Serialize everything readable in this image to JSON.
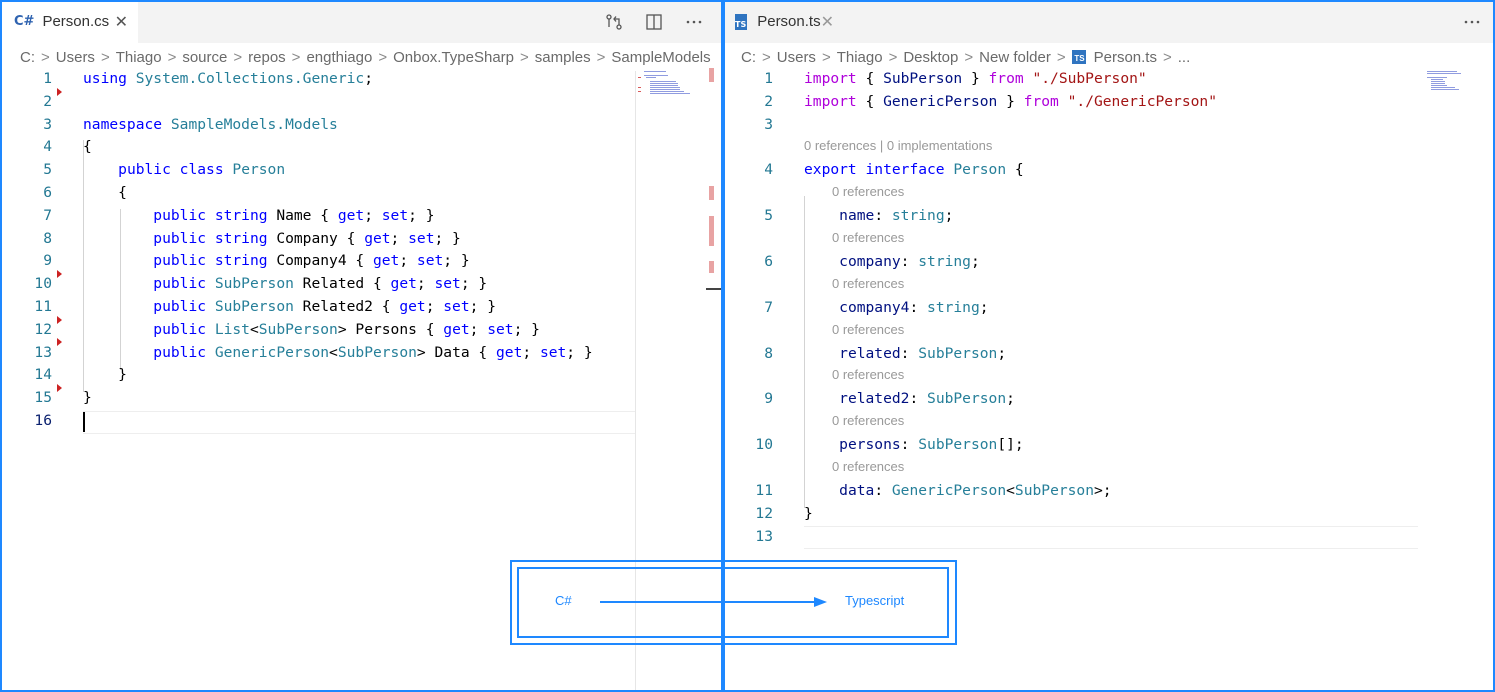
{
  "left_editor": {
    "tab": {
      "icon": "csharp-file-icon",
      "icon_text": "C#",
      "label": "Person.cs",
      "close": "✕"
    },
    "actions": [
      "open-changes-icon",
      "split-editor-icon",
      "more-actions-icon"
    ],
    "breadcrumb": [
      "C:",
      "Users",
      "Thiago",
      "source",
      "repos",
      "engthiago",
      "Onbox.TypeSharp",
      "samples",
      "SampleModels"
    ],
    "line_numbers": [
      "1",
      "2",
      "3",
      "4",
      "5",
      "6",
      "7",
      "8",
      "9",
      "10",
      "11",
      "12",
      "13",
      "14",
      "15",
      "16"
    ],
    "lines": [
      [
        [
          "kw",
          "using"
        ],
        [
          "pl",
          " "
        ],
        [
          "ty",
          "System.Collections.Generic"
        ],
        [
          "pl",
          ";"
        ]
      ],
      [],
      [
        [
          "kw",
          "namespace"
        ],
        [
          "pl",
          " "
        ],
        [
          "ty",
          "SampleModels.Models"
        ]
      ],
      [
        [
          "pl",
          "{"
        ]
      ],
      [
        [
          "pl",
          "    "
        ],
        [
          "kw",
          "public"
        ],
        [
          "pl",
          " "
        ],
        [
          "kw",
          "class"
        ],
        [
          "pl",
          " "
        ],
        [
          "ty",
          "Person"
        ]
      ],
      [
        [
          "pl",
          "    {"
        ]
      ],
      [
        [
          "pl",
          "        "
        ],
        [
          "kw",
          "public"
        ],
        [
          "pl",
          " "
        ],
        [
          "kw",
          "string"
        ],
        [
          "pl",
          " Name { "
        ],
        [
          "kw",
          "get"
        ],
        [
          "pl",
          "; "
        ],
        [
          "kw",
          "set"
        ],
        [
          "pl",
          "; }"
        ]
      ],
      [
        [
          "pl",
          "        "
        ],
        [
          "kw",
          "public"
        ],
        [
          "pl",
          " "
        ],
        [
          "kw",
          "string"
        ],
        [
          "pl",
          " Company { "
        ],
        [
          "kw",
          "get"
        ],
        [
          "pl",
          "; "
        ],
        [
          "kw",
          "set"
        ],
        [
          "pl",
          "; }"
        ]
      ],
      [
        [
          "pl",
          "        "
        ],
        [
          "kw",
          "public"
        ],
        [
          "pl",
          " "
        ],
        [
          "kw",
          "string"
        ],
        [
          "pl",
          " Company4 { "
        ],
        [
          "kw",
          "get"
        ],
        [
          "pl",
          "; "
        ],
        [
          "kw",
          "set"
        ],
        [
          "pl",
          "; }"
        ]
      ],
      [
        [
          "pl",
          "        "
        ],
        [
          "kw",
          "public"
        ],
        [
          "pl",
          " "
        ],
        [
          "ty",
          "SubPerson"
        ],
        [
          "pl",
          " Related { "
        ],
        [
          "kw",
          "get"
        ],
        [
          "pl",
          "; "
        ],
        [
          "kw",
          "set"
        ],
        [
          "pl",
          "; }"
        ]
      ],
      [
        [
          "pl",
          "        "
        ],
        [
          "kw",
          "public"
        ],
        [
          "pl",
          " "
        ],
        [
          "ty",
          "SubPerson"
        ],
        [
          "pl",
          " Related2 { "
        ],
        [
          "kw",
          "get"
        ],
        [
          "pl",
          "; "
        ],
        [
          "kw",
          "set"
        ],
        [
          "pl",
          "; }"
        ]
      ],
      [
        [
          "pl",
          "        "
        ],
        [
          "kw",
          "public"
        ],
        [
          "pl",
          " "
        ],
        [
          "ty",
          "List"
        ],
        [
          "pl",
          "<"
        ],
        [
          "ty",
          "SubPerson"
        ],
        [
          "pl",
          "> Persons { "
        ],
        [
          "kw",
          "get"
        ],
        [
          "pl",
          "; "
        ],
        [
          "kw",
          "set"
        ],
        [
          "pl",
          "; }"
        ]
      ],
      [
        [
          "pl",
          "        "
        ],
        [
          "kw",
          "public"
        ],
        [
          "pl",
          " "
        ],
        [
          "ty",
          "GenericPerson"
        ],
        [
          "pl",
          "<"
        ],
        [
          "ty",
          "SubPerson"
        ],
        [
          "pl",
          "> Data { "
        ],
        [
          "kw",
          "get"
        ],
        [
          "pl",
          "; "
        ],
        [
          "kw",
          "set"
        ],
        [
          "pl",
          "; }"
        ]
      ],
      [
        [
          "pl",
          "    }"
        ]
      ],
      [
        [
          "pl",
          "}"
        ]
      ],
      []
    ]
  },
  "right_editor": {
    "tab": {
      "icon": "typescript-file-icon",
      "icon_text": "TS",
      "label": "Person.ts",
      "close": "✕"
    },
    "actions": [
      "more-actions-icon"
    ],
    "breadcrumb": [
      "C:",
      "Users",
      "Thiago",
      "Desktop",
      "New folder",
      "Person.ts",
      "..."
    ],
    "rows": [
      {
        "kind": "code",
        "num": "1",
        "tokens": [
          [
            "kw2",
            "import"
          ],
          [
            "pl",
            " { "
          ],
          [
            "prop",
            "SubPerson"
          ],
          [
            "pl",
            " } "
          ],
          [
            "kw2",
            "from"
          ],
          [
            "pl",
            " "
          ],
          [
            "str",
            "\"./SubPerson\""
          ]
        ]
      },
      {
        "kind": "code",
        "num": "2",
        "tokens": [
          [
            "kw2",
            "import"
          ],
          [
            "pl",
            " { "
          ],
          [
            "prop",
            "GenericPerson"
          ],
          [
            "pl",
            " } "
          ],
          [
            "kw2",
            "from"
          ],
          [
            "pl",
            " "
          ],
          [
            "str",
            "\"./GenericPerson\""
          ]
        ]
      },
      {
        "kind": "code",
        "num": "3",
        "tokens": []
      },
      {
        "kind": "lens",
        "text": "0 references | 0 implementations",
        "indent": 0
      },
      {
        "kind": "code",
        "num": "4",
        "tokens": [
          [
            "kw",
            "export"
          ],
          [
            "pl",
            " "
          ],
          [
            "kw",
            "interface"
          ],
          [
            "pl",
            " "
          ],
          [
            "ty",
            "Person"
          ],
          [
            "pl",
            " {"
          ]
        ]
      },
      {
        "kind": "lens",
        "text": "0 references",
        "indent": 1
      },
      {
        "kind": "code",
        "num": "5",
        "tokens": [
          [
            "pl",
            "    "
          ],
          [
            "prop",
            "name"
          ],
          [
            "pl",
            ": "
          ],
          [
            "ty",
            "string"
          ],
          [
            "pl",
            ";"
          ]
        ]
      },
      {
        "kind": "lens",
        "text": "0 references",
        "indent": 1
      },
      {
        "kind": "code",
        "num": "6",
        "tokens": [
          [
            "pl",
            "    "
          ],
          [
            "prop",
            "company"
          ],
          [
            "pl",
            ": "
          ],
          [
            "ty",
            "string"
          ],
          [
            "pl",
            ";"
          ]
        ]
      },
      {
        "kind": "lens",
        "text": "0 references",
        "indent": 1
      },
      {
        "kind": "code",
        "num": "7",
        "tokens": [
          [
            "pl",
            "    "
          ],
          [
            "prop",
            "company4"
          ],
          [
            "pl",
            ": "
          ],
          [
            "ty",
            "string"
          ],
          [
            "pl",
            ";"
          ]
        ]
      },
      {
        "kind": "lens",
        "text": "0 references",
        "indent": 1
      },
      {
        "kind": "code",
        "num": "8",
        "tokens": [
          [
            "pl",
            "    "
          ],
          [
            "prop",
            "related"
          ],
          [
            "pl",
            ": "
          ],
          [
            "ty",
            "SubPerson"
          ],
          [
            "pl",
            ";"
          ]
        ]
      },
      {
        "kind": "lens",
        "text": "0 references",
        "indent": 1
      },
      {
        "kind": "code",
        "num": "9",
        "tokens": [
          [
            "pl",
            "    "
          ],
          [
            "prop",
            "related2"
          ],
          [
            "pl",
            ": "
          ],
          [
            "ty",
            "SubPerson"
          ],
          [
            "pl",
            ";"
          ]
        ]
      },
      {
        "kind": "lens",
        "text": "0 references",
        "indent": 1
      },
      {
        "kind": "code",
        "num": "10",
        "tokens": [
          [
            "pl",
            "    "
          ],
          [
            "prop",
            "persons"
          ],
          [
            "pl",
            ": "
          ],
          [
            "ty",
            "SubPerson"
          ],
          [
            "pl",
            "[];"
          ]
        ]
      },
      {
        "kind": "lens",
        "text": "0 references",
        "indent": 1
      },
      {
        "kind": "code",
        "num": "11",
        "tokens": [
          [
            "pl",
            "    "
          ],
          [
            "prop",
            "data"
          ],
          [
            "pl",
            ": "
          ],
          [
            "ty",
            "GenericPerson"
          ],
          [
            "pl",
            "<"
          ],
          [
            "ty",
            "SubPerson"
          ],
          [
            "pl",
            ">;"
          ]
        ]
      },
      {
        "kind": "code",
        "num": "12",
        "tokens": [
          [
            "pl",
            "}"
          ]
        ]
      },
      {
        "kind": "code",
        "num": "13",
        "tokens": []
      }
    ]
  },
  "annotation": {
    "from_label": "C#",
    "to_label": "Typescript"
  },
  "colors": {
    "accent": "#1e88ff",
    "keyword": "#0000ff",
    "control_keyword": "#af00db",
    "type": "#267f99",
    "string": "#a31515",
    "property": "#001080",
    "line_number": "#237893"
  }
}
